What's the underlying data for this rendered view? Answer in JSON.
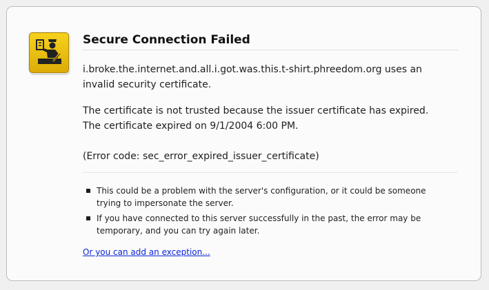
{
  "error": {
    "icon": "certificate-inspector-icon",
    "title": "Secure Connection Failed",
    "site_message": "i.broke.the.internet.and.all.i.got.was.this.t-shirt.phreedom.org uses an invalid security certificate.",
    "trust_reason": "The certificate is not trusted because the issuer certificate has expired.",
    "expiry_message": "The certificate expired on 9/1/2004 6:00 PM.",
    "error_code": "(Error code: sec_error_expired_issuer_certificate)"
  },
  "advice": {
    "items": [
      "This could be a problem with the server's configuration, or it could be someone trying to impersonate the server.",
      "If you have connected to this server successfully in the past, the error may be temporary, and you can try again later."
    ]
  },
  "exception_link": "Or you can add an exception...",
  "colors": {
    "icon_background": "#f2c511",
    "link": "#0b24d6"
  }
}
